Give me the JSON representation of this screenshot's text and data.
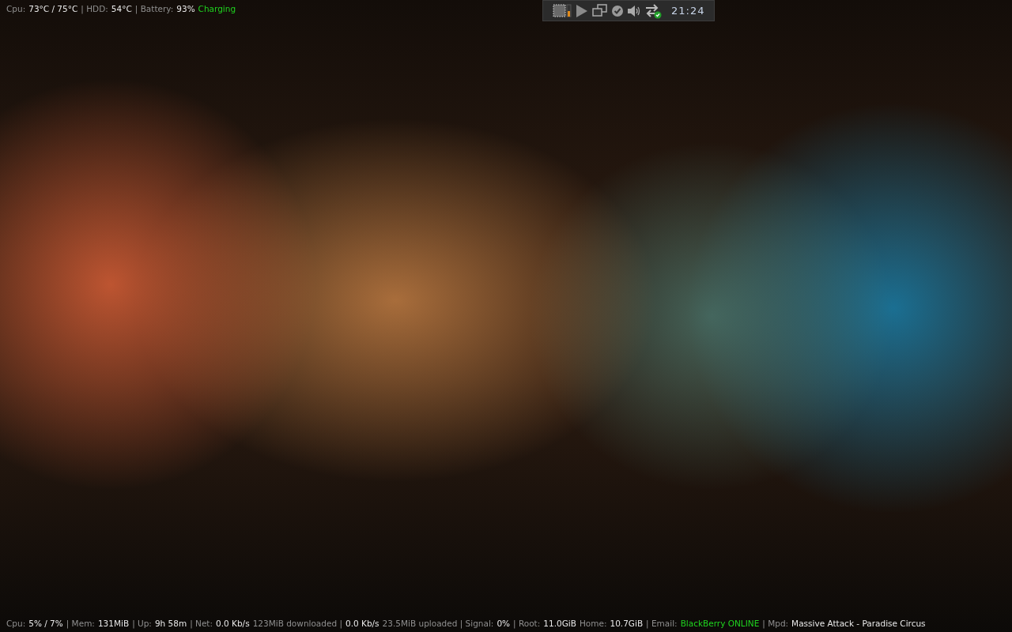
{
  "top_bar": {
    "segments": [
      {
        "text": "Cpu:",
        "kind": "label"
      },
      {
        "text": "73°C / 75°C",
        "kind": "value"
      },
      {
        "text": "| HDD:",
        "kind": "label"
      },
      {
        "text": "54°C",
        "kind": "value"
      },
      {
        "text": "| Battery:",
        "kind": "label"
      },
      {
        "text": "93%",
        "kind": "value"
      },
      {
        "text": "Charging",
        "kind": "status"
      }
    ]
  },
  "tray": {
    "clock": "21:24"
  },
  "bottom_bar": {
    "segments": [
      {
        "text": "Cpu:",
        "kind": "label"
      },
      {
        "text": "5% / 7%",
        "kind": "value"
      },
      {
        "text": "| Mem:",
        "kind": "label"
      },
      {
        "text": "131MiB",
        "kind": "value"
      },
      {
        "text": "| Up:",
        "kind": "label"
      },
      {
        "text": "9h 58m",
        "kind": "value"
      },
      {
        "text": "| Net:",
        "kind": "label"
      },
      {
        "text": "0.0 Kb/s",
        "kind": "value"
      },
      {
        "text": "123MiB downloaded |",
        "kind": "label"
      },
      {
        "text": "0.0 Kb/s",
        "kind": "value"
      },
      {
        "text": "23.5MiB uploaded | Signal:",
        "kind": "label"
      },
      {
        "text": "0%",
        "kind": "value"
      },
      {
        "text": "| Root:",
        "kind": "label"
      },
      {
        "text": "11.0GiB",
        "kind": "value"
      },
      {
        "text": "Home:",
        "kind": "label"
      },
      {
        "text": "10.7GiB",
        "kind": "value"
      },
      {
        "text": "| Email:",
        "kind": "label"
      },
      {
        "text": "BlackBerry ONLINE",
        "kind": "status"
      },
      {
        "text": "| Mpd:",
        "kind": "label"
      },
      {
        "text": "Massive Attack - Paradise Circus",
        "kind": "value"
      }
    ]
  }
}
